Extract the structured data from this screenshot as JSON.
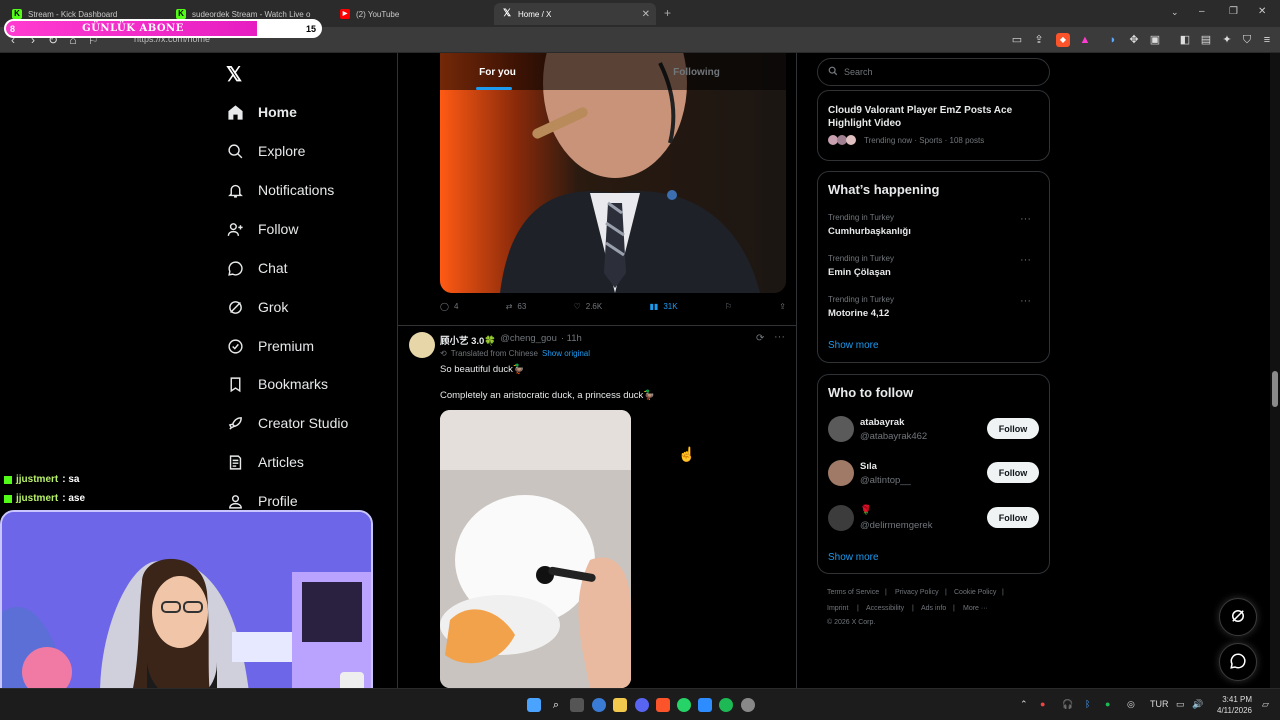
{
  "browser": {
    "tabs": [
      {
        "label": "Stream - Kick Dashboard",
        "icon": "kick-icon"
      },
      {
        "label": "sudeordek Stream - Watch Live o",
        "icon": "kick-icon"
      },
      {
        "label": "(2) YouTube",
        "icon": "youtube-icon"
      },
      {
        "label": "Home / X",
        "icon": "x-icon"
      }
    ],
    "new_tab": "+",
    "url": "https://x.com/home"
  },
  "overlay": {
    "left_num": "8",
    "title": "GÜNLÜK ABONE",
    "right_num": "15"
  },
  "sidebar": {
    "logo": "X",
    "items": [
      {
        "label": "Home",
        "icon": "home-icon"
      },
      {
        "label": "Explore",
        "icon": "search-icon"
      },
      {
        "label": "Notifications",
        "icon": "bell-icon"
      },
      {
        "label": "Follow",
        "icon": "person-add-icon"
      },
      {
        "label": "Chat",
        "icon": "chat-icon"
      },
      {
        "label": "Grok",
        "icon": "grok-icon"
      },
      {
        "label": "Premium",
        "icon": "premium-icon"
      },
      {
        "label": "Bookmarks",
        "icon": "bookmark-icon"
      },
      {
        "label": "Creator Studio",
        "icon": "rocket-icon"
      },
      {
        "label": "Articles",
        "icon": "article-icon"
      },
      {
        "label": "Profile",
        "icon": "person-icon"
      }
    ]
  },
  "feed": {
    "tabs": [
      "For you",
      "Following"
    ],
    "post1": {
      "replies": "4",
      "reposts": "63",
      "likes": "2.6K",
      "views": "31K"
    },
    "post2": {
      "name": "顾小艺 3.0🍀",
      "handle": "@cheng_gou",
      "time": "· 11h",
      "translated": "Translated from Chinese",
      "show_original": "Show original",
      "text1": "So beautiful duck🦆",
      "text2": "Completely an aristocratic duck, a princess duck🦆"
    }
  },
  "right": {
    "search_placeholder": "Search",
    "top_trend": {
      "title": "Cloud9 Valorant Player EmZ Posts Ace Highlight Video",
      "meta": "Trending now · Sports · 108 posts"
    },
    "happening": {
      "title": "What’s happening",
      "trends": [
        {
          "meta": "Trending in Turkey",
          "name": "Cumhurbaşkanlığı"
        },
        {
          "meta": "Trending in Turkey",
          "name": "Emin Çölaşan"
        },
        {
          "meta": "Trending in Turkey",
          "name": "Motorine 4,12"
        }
      ],
      "show_more": "Show more"
    },
    "who_to_follow": {
      "title": "Who to follow",
      "users": [
        {
          "name": "atabayrak",
          "handle": "@atabayrak462",
          "button": "Follow"
        },
        {
          "name": "Sıla",
          "handle": "@altintop__",
          "button": "Follow"
        },
        {
          "name": "🌹",
          "handle": "@delirmemgerek",
          "button": "Follow"
        }
      ],
      "show_more": "Show more"
    },
    "footer": {
      "links": [
        "Terms of Service",
        "Privacy Policy",
        "Cookie Policy",
        "Imprint",
        "Accessibility",
        "Ads info",
        "More ···"
      ],
      "copyright": "© 2026 X Corp."
    }
  },
  "chat": [
    {
      "user": "jjustmert",
      "msg": ": sa"
    },
    {
      "user": "jjustmert",
      "msg": ": ase"
    }
  ],
  "taskbar": {
    "lang": "TUR",
    "time": "3:41 PM",
    "date": "4/11/2026"
  },
  "colors": {
    "accent": "#1d9bf0",
    "overlay_pink": "#ff3bd0",
    "chat_user": "#b7f06a"
  }
}
